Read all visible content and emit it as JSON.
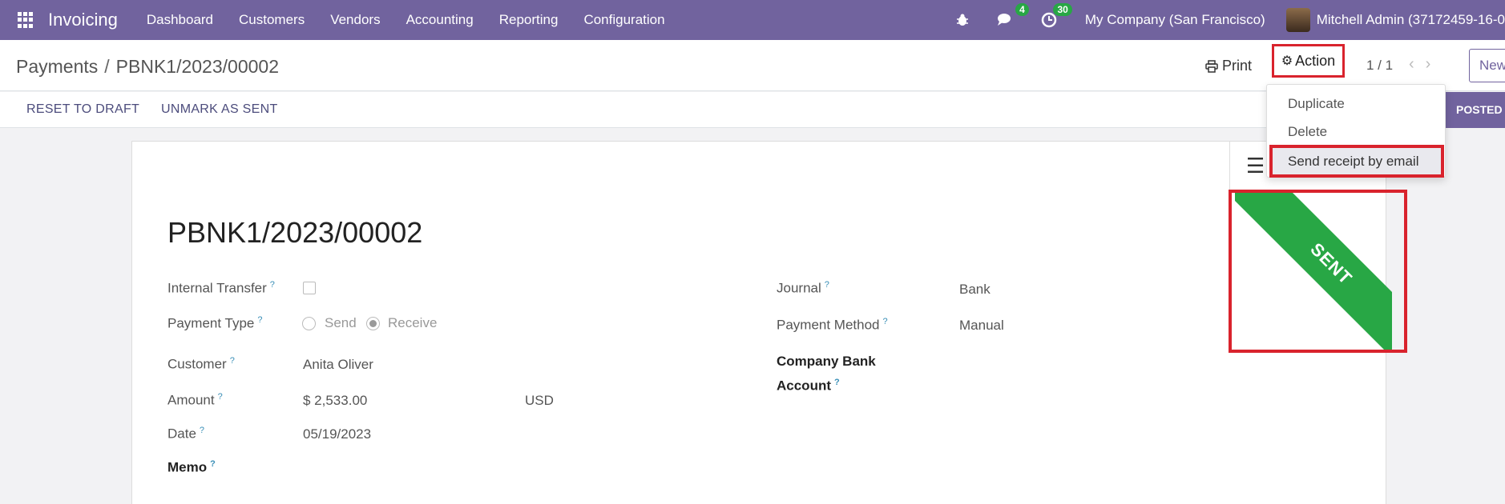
{
  "navbar": {
    "app_name": "Invoicing",
    "menu": [
      "Dashboard",
      "Customers",
      "Vendors",
      "Accounting",
      "Reporting",
      "Configuration"
    ],
    "messages_count": "4",
    "activities_count": "30",
    "company": "My Company (San Francisco)",
    "user": "Mitchell Admin (37172459-16-0"
  },
  "control": {
    "breadcrumb_parent": "Payments",
    "breadcrumb_sep": "/",
    "breadcrumb_current": "PBNK1/2023/00002",
    "print_label": "Print",
    "action_label": "Action",
    "pager": "1 / 1",
    "new_label": "New"
  },
  "statusbar": {
    "reset_label": "RESET TO DRAFT",
    "unmark_label": "UNMARK AS SENT",
    "state": "POSTED"
  },
  "dropdown": {
    "items": [
      "Duplicate",
      "Delete",
      "Send receipt by email"
    ]
  },
  "form": {
    "title": "PBNK1/2023/00002",
    "ribbon": "SENT",
    "help_mark": "?",
    "labels": {
      "internal_transfer": "Internal Transfer",
      "payment_type": "Payment Type",
      "customer": "Customer",
      "amount": "Amount",
      "date": "Date",
      "memo": "Memo",
      "journal": "Journal",
      "payment_method": "Payment Method",
      "company_bank_1": "Company Bank",
      "company_bank_2": "Account"
    },
    "values": {
      "send": "Send",
      "receive": "Receive",
      "customer": "Anita Oliver",
      "amount": "$ 2,533.00",
      "currency": "USD",
      "date": "05/19/2023",
      "journal": "Bank",
      "payment_method": "Manual"
    }
  }
}
